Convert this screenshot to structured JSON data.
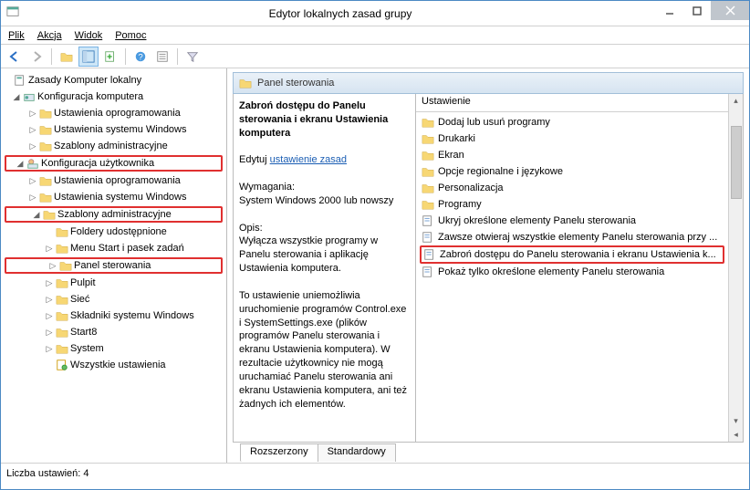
{
  "window": {
    "title": "Edytor lokalnych zasad grupy"
  },
  "menu": {
    "file": "Plik",
    "action": "Akcja",
    "view": "Widok",
    "help": "Pomoc"
  },
  "tree": {
    "root": "Zasady Komputer lokalny",
    "computer_config": "Konfiguracja komputera",
    "software_settings": "Ustawienia oprogramowania",
    "windows_settings": "Ustawienia systemu Windows",
    "admin_templates": "Szablony administracyjne",
    "user_config": "Konfiguracja użytkownika",
    "shared_folders": "Foldery udostępnione",
    "start_taskbar": "Menu Start i pasek zadań",
    "control_panel": "Panel sterowania",
    "desktop": "Pulpit",
    "network": "Sieć",
    "windows_components": "Składniki systemu Windows",
    "start8": "Start8",
    "system": "System",
    "all_settings": "Wszystkie ustawienia"
  },
  "panel": {
    "title": "Panel sterowania",
    "setting_title": "Zabroń dostępu do Panelu sterowania i ekranu Ustawienia komputera",
    "edit_label": "Edytuj",
    "edit_link": "ustawienie zasad",
    "req_label": "Wymagania:",
    "req_text": "System Windows 2000 lub nowszy",
    "desc_label": "Opis:",
    "desc_1": "Wyłącza wszystkie programy w Panelu sterowania i aplikację Ustawienia komputera.",
    "desc_2": "To ustawienie uniemożliwia uruchomienie programów Control.exe i SystemSettings.exe (plików programów Panelu sterowania i ekranu Ustawienia komputera). W rezultacie użytkownicy nie mogą uruchamiać Panelu sterowania ani ekranu Ustawienia komputera, ani też żadnych ich elementów."
  },
  "list": {
    "header": "Ustawienie",
    "items": [
      "Dodaj lub usuń programy",
      "Drukarki",
      "Ekran",
      "Opcje regionalne i językowe",
      "Personalizacja",
      "Programy",
      "Ukryj określone elementy Panelu sterowania",
      "Zawsze otwieraj wszystkie elementy Panelu sterowania przy ...",
      "Zabroń dostępu do Panelu sterowania i ekranu Ustawienia k...",
      "Pokaż tylko określone elementy Panelu sterowania"
    ]
  },
  "tabs": {
    "ext": "Rozszerzony",
    "std": "Standardowy"
  },
  "status": {
    "text": "Liczba ustawień: 4"
  }
}
